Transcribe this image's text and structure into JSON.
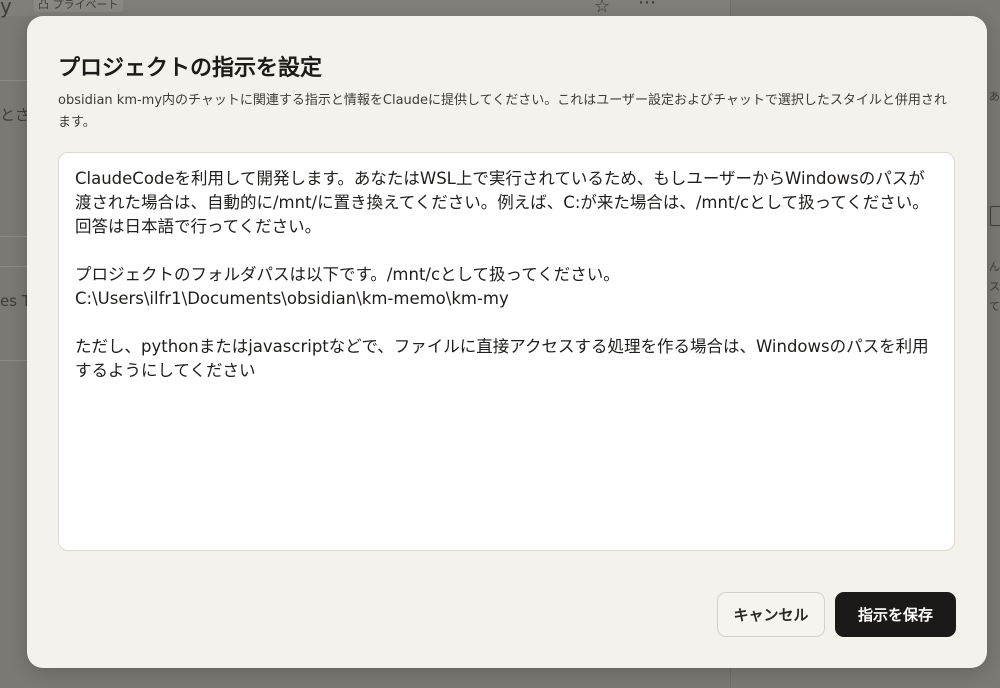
{
  "background": {
    "project_title_fragment": "y",
    "private_badge": "凸 プライベート",
    "star_icon": "star-outline",
    "more_icon": "ellipsis",
    "left_text_1": "とさせ",
    "left_text_2": "es T",
    "right_text_1": "あ",
    "right_text_2": "ん",
    "right_text_3": "ス",
    "right_text_4": "て"
  },
  "dialog": {
    "title": "プロジェクトの指示を設定",
    "description": "obsidian km-my内のチャットに関連する指示と情報をClaudeに提供してください。これはユーザー設定およびチャットで選択したスタイルと併用されます。",
    "instructions_value": "ClaudeCodeを利用して開発します。あなたはWSL上で実行されているため、もしユーザーからWindowsのパスが渡された場合は、自動的に/mnt/に置き換えてください。例えば、C:が来た場合は、/mnt/cとして扱ってください。回答は日本語で行ってください。\n\nプロジェクトのフォルダパスは以下です。/mnt/cとして扱ってください。\nC:\\Users\\ilfr1\\Documents\\obsidian\\km-memo\\km-my\n\nただし、pythonまたはjavascriptなどで、ファイルに直接アクセスする処理を作る場合は、Windowsのパスを利用するようにしてください",
    "cancel_label": "キャンセル",
    "save_label": "指示を保存"
  },
  "colors": {
    "modal_bg": "#f4f2ec",
    "primary_button": "#1b1a18",
    "overlay": "#7a7974"
  }
}
